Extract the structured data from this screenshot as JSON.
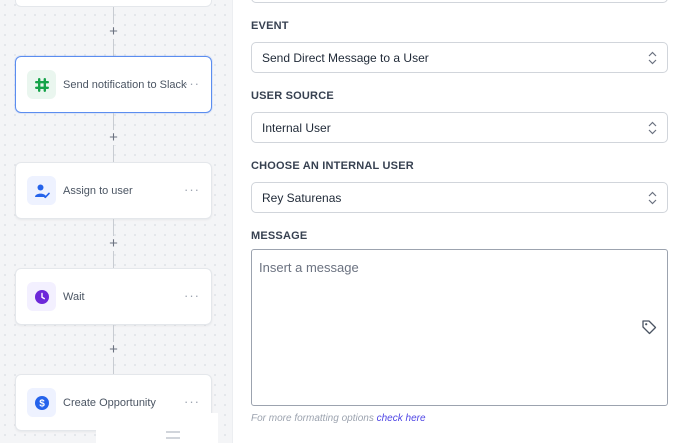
{
  "workflow": {
    "steps": [
      {
        "label": "Send notification to Slack",
        "icon": "slack-icon",
        "icon_bg": "#eaf6ef",
        "selected": true
      },
      {
        "label": "Assign to user",
        "icon": "assign-user-icon",
        "icon_bg": "#eef2ff"
      },
      {
        "label": "Wait",
        "icon": "clock-icon",
        "icon_bg": "#f3f0ff"
      },
      {
        "label": "Create Opportunity",
        "icon": "dollar-icon",
        "icon_bg": "#eef2ff"
      }
    ],
    "add_symbol": "+",
    "more_symbol": "···"
  },
  "form": {
    "event": {
      "label": "EVENT",
      "value": "Send Direct Message to a User"
    },
    "user_source": {
      "label": "USER SOURCE",
      "value": "Internal User"
    },
    "internal_user": {
      "label": "CHOOSE AN INTERNAL USER",
      "value": "Rey Saturenas"
    },
    "message": {
      "label": "MESSAGE",
      "placeholder": "Insert a message"
    },
    "hint": {
      "text": "For more formatting options",
      "link": "check here"
    }
  },
  "colors": {
    "selected_border": "#5b8def",
    "slack_green": "#16a34a",
    "accent_blue": "#2563eb",
    "accent_purple": "#6d28d9",
    "link": "#4f46e5"
  }
}
